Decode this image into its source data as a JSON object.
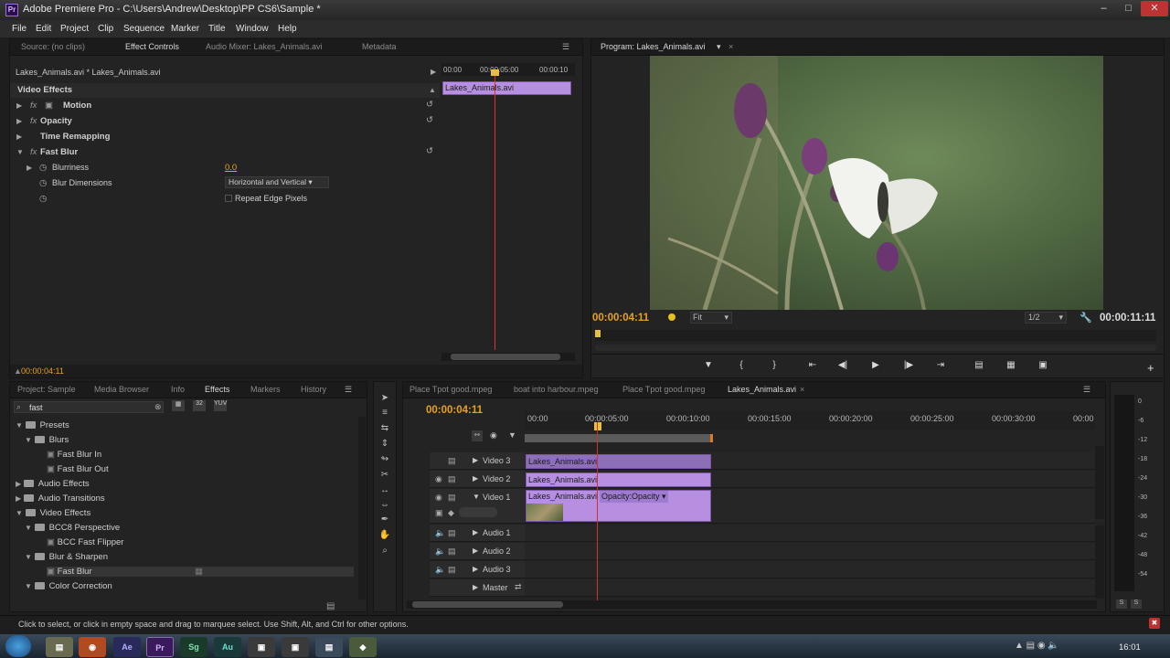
{
  "window": {
    "title": "Adobe Premiere Pro - C:\\Users\\Andrew\\Desktop\\PP CS6\\Sample *",
    "logo": "Pr"
  },
  "menu": [
    "File",
    "Edit",
    "Project",
    "Clip",
    "Sequence",
    "Marker",
    "Title",
    "Window",
    "Help"
  ],
  "source_panel": {
    "tabs": [
      "Source: (no clips)",
      "Effect Controls",
      "Audio Mixer: Lakes_Animals.avi",
      "Metadata"
    ],
    "clip_path": "Lakes_Animals.avi * Lakes_Animals.avi",
    "ruler": [
      "00:00",
      "00:00:05:00",
      "00:00:10"
    ],
    "clip_label": "Lakes_Animals.avi",
    "section": "Video Effects",
    "effects": [
      {
        "label": "Motion"
      },
      {
        "label": "Opacity"
      },
      {
        "label": "Time Remapping"
      },
      {
        "label": "Fast Blur"
      }
    ],
    "blurriness_label": "Blurriness",
    "blurriness_value": "0.0",
    "blur_dims_label": "Blur Dimensions",
    "blur_dims_value": "Horizontal and Vertical",
    "repeat_edge": "Repeat Edge Pixels",
    "timecode": "00:00:04:11"
  },
  "program_panel": {
    "tab": "Program: Lakes_Animals.avi",
    "timecode": "00:00:04:11",
    "fit": "Fit",
    "resolution": "1/2",
    "duration": "00:00:11:11"
  },
  "project_panel": {
    "tabs": [
      "Project: Sample",
      "Media Browser",
      "Info",
      "Effects",
      "Markers",
      "History"
    ],
    "search": "fast",
    "tree": [
      {
        "label": "Presets",
        "level": 0,
        "open": true
      },
      {
        "label": "Blurs",
        "level": 1,
        "open": true
      },
      {
        "label": "Fast Blur In",
        "level": 2
      },
      {
        "label": "Fast Blur Out",
        "level": 2
      },
      {
        "label": "Audio Effects",
        "level": 0
      },
      {
        "label": "Audio Transitions",
        "level": 0
      },
      {
        "label": "Video Effects",
        "level": 0,
        "open": true
      },
      {
        "label": "BCC8 Perspective",
        "level": 1,
        "open": true
      },
      {
        "label": "BCC Fast Flipper",
        "level": 2
      },
      {
        "label": "Blur & Sharpen",
        "level": 1,
        "open": true
      },
      {
        "label": "Fast Blur",
        "level": 2
      },
      {
        "label": "Color Correction",
        "level": 1,
        "open": true
      }
    ]
  },
  "timeline": {
    "tabs": [
      "Place Tpot good.mpeg",
      "boat into harbour.mpeg",
      "Place Tpot good.mpeg",
      "Lakes_Animals.avi"
    ],
    "timecode": "00:00:04:11",
    "ruler": [
      "00:00",
      "00:00:05:00",
      "00:00:10:00",
      "00:00:15:00",
      "00:00:20:00",
      "00:00:25:00",
      "00:00:30:00",
      "00:00"
    ],
    "tracks": [
      "Video 3",
      "Video 2",
      "Video 1",
      "Audio 1",
      "Audio 2",
      "Audio 3",
      "Master"
    ],
    "clip_name": "Lakes_Animals.avi",
    "opacity_label": "Opacity:Opacity"
  },
  "meter_scale": [
    "0",
    "-6",
    "-12",
    "-18",
    "-24",
    "-30",
    "-36",
    "-42",
    "-48",
    "-54"
  ],
  "status": "Click to select, or click in empty space and drag to marquee select. Use Shift, Alt, and Ctrl for other options.",
  "taskbar": {
    "clock": "16:01",
    "apps": [
      "Ae",
      "Pr",
      "Sg",
      "Au"
    ]
  }
}
